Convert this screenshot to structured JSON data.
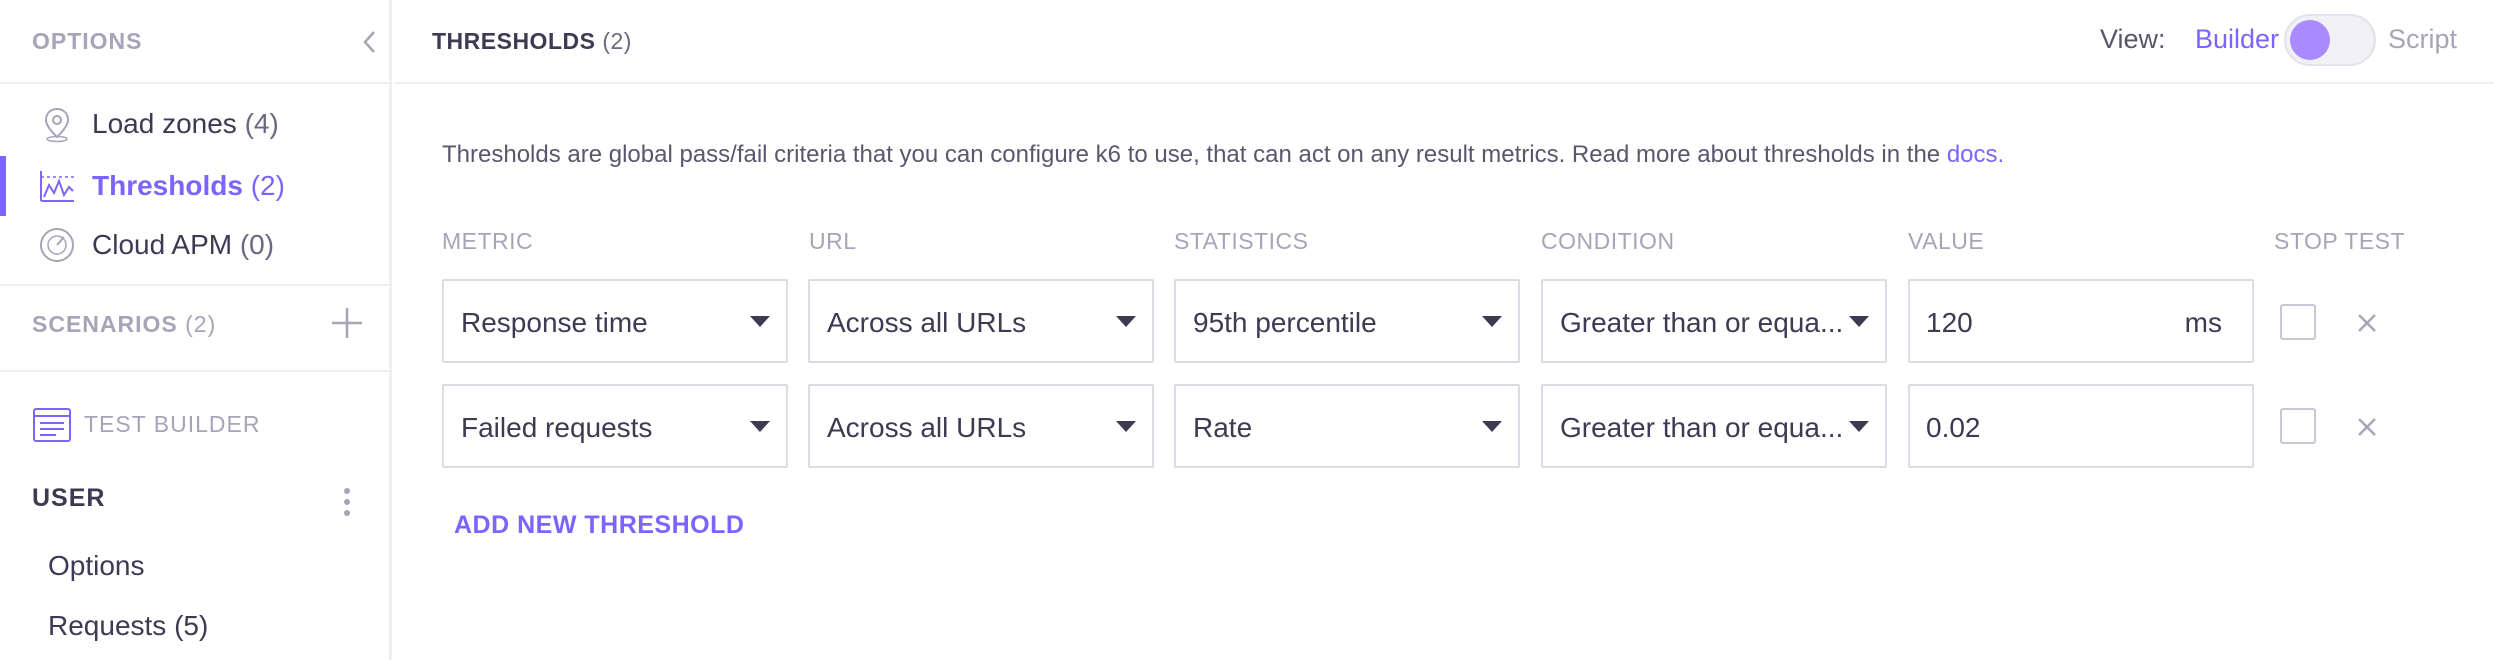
{
  "sidebar": {
    "title": "OPTIONS",
    "collapse_icon": "chevron-left-icon",
    "options": [
      {
        "label": "Load zones",
        "count": "(4)",
        "icon": "location-pin-icon",
        "active": false
      },
      {
        "label": "Thresholds",
        "count": "(2)",
        "icon": "thresholds-chart-icon",
        "active": true
      },
      {
        "label": "Cloud APM",
        "count": "(0)",
        "icon": "gauge-icon",
        "active": false
      }
    ],
    "scenarios": {
      "label": "SCENARIOS",
      "count": "(2)",
      "add_icon": "plus-icon"
    },
    "test_builder": {
      "label": "TEST BUILDER",
      "icon": "test-builder-icon"
    },
    "user": {
      "label": "USER",
      "more_icon": "vertical-dots-icon",
      "items": [
        {
          "label": "Options"
        },
        {
          "label": "Requests (5)"
        }
      ]
    }
  },
  "header": {
    "title": "THRESHOLDS",
    "count": "(2)",
    "view_label": "View:",
    "view_builder": "Builder",
    "view_script": "Script",
    "toggle_state": "builder"
  },
  "description": {
    "text": "Thresholds are global pass/fail criteria that you can configure k6 to use, that can act on any result metrics. Read more about thresholds in the ",
    "link": "docs."
  },
  "columns": {
    "metric": "METRIC",
    "url": "URL",
    "statistics": "STATISTICS",
    "condition": "CONDITION",
    "value": "VALUE",
    "stop_test": "STOP TEST"
  },
  "rows": [
    {
      "metric": "Response time",
      "url": "Across all URLs",
      "statistics": "95th percentile",
      "condition": "Greater than or equa...",
      "value": "120",
      "unit": "ms",
      "stop_test": false
    },
    {
      "metric": "Failed requests",
      "url": "Across all URLs",
      "statistics": "Rate",
      "condition": "Greater than or equa...",
      "value": "0.02",
      "unit": "",
      "stop_test": false
    }
  ],
  "add_threshold_label": "ADD NEW THRESHOLD",
  "colors": {
    "accent": "#7d64ff",
    "muted": "#a7a4b8",
    "text": "#3d3a52",
    "border": "#dcdbe3"
  }
}
